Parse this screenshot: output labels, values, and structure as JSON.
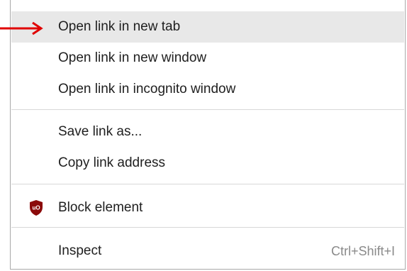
{
  "context_menu": {
    "items": [
      {
        "label": "Open link in new tab"
      },
      {
        "label": "Open link in new window"
      },
      {
        "label": "Open link in incognito window"
      },
      {
        "label": "Save link as..."
      },
      {
        "label": "Copy link address"
      },
      {
        "label": "Block element",
        "icon": "ublock-origin-icon"
      },
      {
        "label": "Inspect",
        "shortcut": "Ctrl+Shift+I"
      }
    ]
  },
  "colors": {
    "hover_background": "#e8e8e8",
    "annotation_arrow": "#e00000",
    "ublock_icon": "#8b0a0a"
  }
}
